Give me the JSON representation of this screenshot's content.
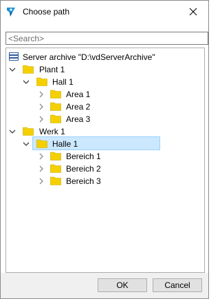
{
  "dialog": {
    "title": "Choose path",
    "close_icon": "close-icon",
    "app_icon": "app-logo-icon"
  },
  "search": {
    "placeholder": "<Search>",
    "value": ""
  },
  "tree": {
    "root": {
      "label": "Server archive \"D:\\vdServerArchive\"",
      "icon": "server-archive-icon"
    },
    "nodes": [
      {
        "label": "Plant 1",
        "expanded": true
      },
      {
        "label": "Hall 1",
        "expanded": true
      },
      {
        "label": "Area 1",
        "expanded": false
      },
      {
        "label": "Area 2",
        "expanded": false
      },
      {
        "label": "Area 3",
        "expanded": false
      },
      {
        "label": "Werk 1",
        "expanded": true
      },
      {
        "label": "Halle 1",
        "expanded": true,
        "selected": true
      },
      {
        "label": "Bereich 1",
        "expanded": false
      },
      {
        "label": "Bereich 2",
        "expanded": false
      },
      {
        "label": "Bereich 3",
        "expanded": false
      }
    ],
    "folder_color": "#f5d000",
    "selection_color": "#cce8ff"
  },
  "buttons": {
    "ok": "OK",
    "cancel": "Cancel"
  }
}
